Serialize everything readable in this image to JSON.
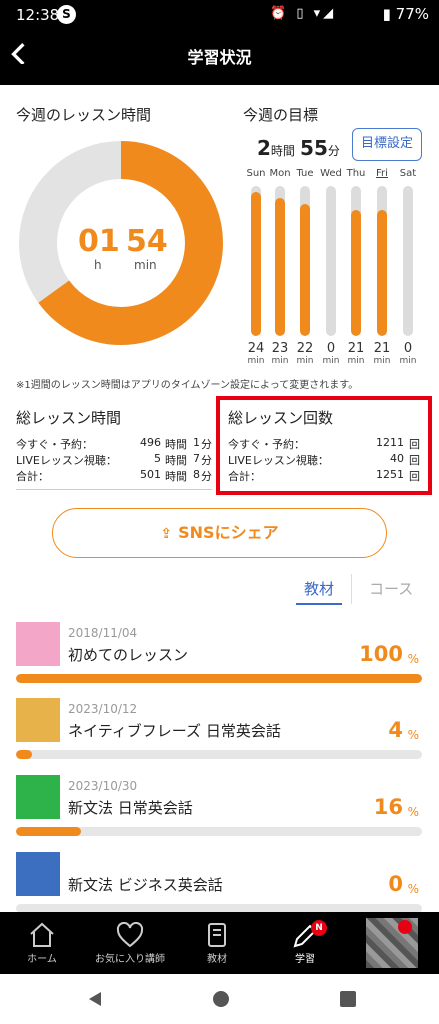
{
  "status": {
    "time": "12:38",
    "s_badge": "S",
    "icons": "⏰ ▯ ▾◢",
    "battery": "▮ 77%"
  },
  "app": {
    "title": "学習状況"
  },
  "week_time": {
    "title": "今週のレッスン時間",
    "hours": "01",
    "minutes": "54",
    "h_unit": "h",
    "min_unit": "min",
    "fraction": 0.65
  },
  "week_goal": {
    "title": "今週の目標",
    "hours": "2",
    "hours_unit": "時間",
    "minutes": "55",
    "minutes_unit": "分",
    "button": "目標設定",
    "bar_max": 25,
    "days": [
      {
        "label": "Sun",
        "value": "24",
        "unit": "min",
        "v": 24
      },
      {
        "label": "Mon",
        "value": "23",
        "unit": "min",
        "v": 23
      },
      {
        "label": "Tue",
        "value": "22",
        "unit": "min",
        "v": 22
      },
      {
        "label": "Wed",
        "value": "0",
        "unit": "min",
        "v": 0
      },
      {
        "label": "Thu",
        "value": "21",
        "unit": "min",
        "v": 21
      },
      {
        "label": "Fri",
        "value": "21",
        "unit": "min",
        "v": 21
      },
      {
        "label": "Sat",
        "value": "0",
        "unit": "min",
        "v": 0
      }
    ]
  },
  "note": "※1週間のレッスン時間はアプリのタイムゾーン設定によって変更されます。",
  "total_time": {
    "title": "総レッスン時間",
    "rows": [
      {
        "label": "今すぐ・予約：",
        "value": "496",
        "u1": "時間",
        "v2": "1",
        "u2": "分"
      },
      {
        "label": "LIVEレッスン視聴：",
        "value": "5",
        "u1": "時間",
        "v2": "7",
        "u2": "分"
      },
      {
        "label": "合計：",
        "value": "501",
        "u1": "時間",
        "v2": "8",
        "u2": "分"
      }
    ]
  },
  "total_count": {
    "title": "総レッスン回数",
    "rows": [
      {
        "label": "今すぐ・予約：",
        "value": "1211",
        "unit": "回"
      },
      {
        "label": "LIVEレッスン視聴：",
        "value": "40",
        "unit": "回"
      },
      {
        "label": "合計：",
        "value": "1251",
        "unit": "回"
      }
    ]
  },
  "share": {
    "label": "SNSにシェア"
  },
  "tabs": {
    "materials": "教材",
    "courses": "コース"
  },
  "list": [
    {
      "date": "2018/11/04",
      "title": "初めてのレッスン",
      "pct": "100",
      "pct_sign": "%",
      "progress": 1.0
    },
    {
      "date": "2023/10/12",
      "title": "ネイティブフレーズ 日常英会話",
      "pct": "4",
      "pct_sign": "%",
      "progress": 0.04
    },
    {
      "date": "2023/10/30",
      "title": "新文法 日常英会話",
      "pct": "16",
      "pct_sign": "%",
      "progress": 0.16
    },
    {
      "date": "",
      "title": "新文法 ビジネス英会話",
      "pct": "0",
      "pct_sign": "%",
      "progress": 0.0
    }
  ],
  "nav": {
    "home": "ホーム",
    "favorites": "お気に入り講師",
    "materials": "教材",
    "study": "学習",
    "badge": "N"
  },
  "colors": {
    "accent": "#f08a1c",
    "highlight": "#e60012",
    "link": "#3b6ac8"
  }
}
